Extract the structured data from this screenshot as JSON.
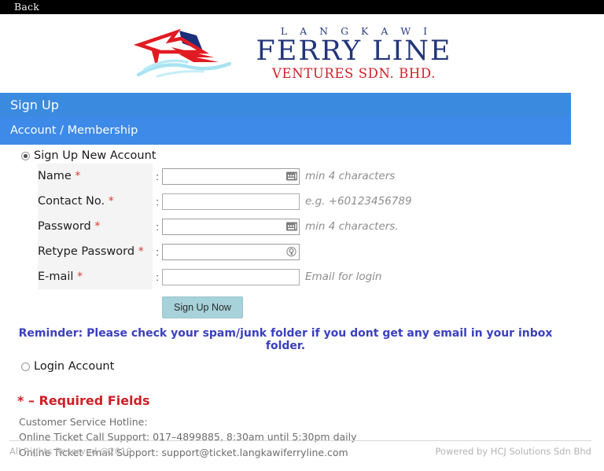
{
  "topbar": {
    "back_label": "Back"
  },
  "logo": {
    "line1": "L A N G K A W I",
    "line2": "FERRY LINE",
    "line3": "VENTURES SDN. BHD.",
    "mark_icon": "ferry-boat-logo-icon",
    "navy": "#22357a",
    "red": "#cf2028",
    "cyan": "#9fdff0"
  },
  "header": {
    "title": "Sign Up",
    "subtitle": "Account / Membership",
    "title_bg": "#3a8ae0",
    "subtitle_bg": "#3d8ae8"
  },
  "account_options": {
    "signup": {
      "label": "Sign Up New Account",
      "selected": true
    },
    "login": {
      "label": "Login Account",
      "selected": false
    }
  },
  "form": {
    "colon": ":",
    "rows": [
      {
        "label": "Name",
        "required_mark": "*",
        "value": "",
        "placeholder": "",
        "hint": "min 4 characters",
        "icon": "autofill-keyboard-icon",
        "field_name": "name-field"
      },
      {
        "label": "Contact No.",
        "required_mark": "*",
        "value": "",
        "placeholder": "",
        "hint": "e.g. +60123456789",
        "icon": "",
        "field_name": "contact-no-field"
      },
      {
        "label": "Password",
        "required_mark": "*",
        "value": "",
        "placeholder": "",
        "hint": "min 4 characters.",
        "icon": "autofill-keyboard-icon",
        "field_name": "password-field"
      },
      {
        "label": "Retype Password",
        "required_mark": "*",
        "value": "",
        "placeholder": "",
        "hint": "",
        "icon": "password-key-icon",
        "field_name": "retype-password-field"
      },
      {
        "label": "E-mail",
        "required_mark": "*",
        "value": "",
        "placeholder": "",
        "hint": "Email for login",
        "icon": "",
        "field_name": "email-field"
      }
    ],
    "submit_label": "Sign Up Now",
    "submit_bg": "#a7d2d9"
  },
  "reminder": {
    "text": "Reminder: Please check your spam/junk folder if you dont get any email in your inbox folder.",
    "color": "#3a40c0"
  },
  "required_note": {
    "text": "* – Required Fields",
    "color": "#cf2028"
  },
  "contact_info": {
    "line1": "Customer Service Hotline:",
    "line2": "Online Ticket Call Support: 017–4899885, 8:30am until 5:30pm daily",
    "line3": "Online Ticket Email Support: support@ticket.langkawiferryline.com"
  },
  "footer": {
    "left": "All Rights Reserved @2019",
    "right": "Powered by HCJ Solutions Sdn Bhd"
  }
}
